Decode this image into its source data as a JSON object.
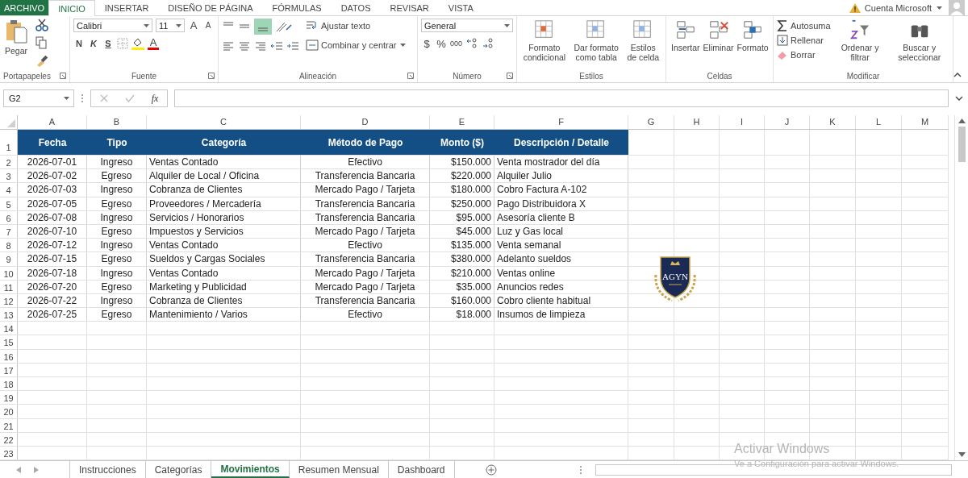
{
  "menu_tabs": [
    {
      "label": "ARCHIVO",
      "kind": "file",
      "selected": false
    },
    {
      "label": "INICIO",
      "kind": "tab",
      "selected": true
    },
    {
      "label": "INSERTAR",
      "kind": "tab",
      "selected": false
    },
    {
      "label": "DISEÑO DE PÁGINA",
      "kind": "tab",
      "selected": false
    },
    {
      "label": "FÓRMULAS",
      "kind": "tab",
      "selected": false
    },
    {
      "label": "DATOS",
      "kind": "tab",
      "selected": false
    },
    {
      "label": "REVISAR",
      "kind": "tab",
      "selected": false
    },
    {
      "label": "VISTA",
      "kind": "tab",
      "selected": false
    }
  ],
  "account": "Cuenta Microsoft",
  "ribbon": {
    "clipboard": {
      "paste": "Pegar",
      "label": "Portapapeles"
    },
    "font": {
      "name": "Calibri",
      "size": "11",
      "grow": "A",
      "shrink": "A",
      "bold": "N",
      "italic": "K",
      "underline": "S",
      "font_color": "A",
      "label": "Fuente"
    },
    "alignment": {
      "wrap": "Ajustar texto",
      "merge": "Combinar y centrar",
      "label": "Alineación"
    },
    "number": {
      "format": "General",
      "currency": "$",
      "percent": "%",
      "thousands": "000",
      "label": "Número"
    },
    "styles": {
      "buttons": [
        "Formato condicional",
        "Dar formato como tabla",
        "Estilos de celda"
      ],
      "label": "Estilos"
    },
    "cells": {
      "buttons": [
        "Insertar",
        "Eliminar",
        "Formato"
      ],
      "label": "Celdas"
    },
    "editing": {
      "autosum": "Autosuma",
      "fill": "Rellenar",
      "clear": "Borrar",
      "sort": "Ordenar y filtrar",
      "find": "Buscar y seleccionar",
      "label": "Modificar"
    }
  },
  "formula_bar": {
    "name_box": "G2",
    "function_label": "fx"
  },
  "columns": [
    "A",
    "B",
    "C",
    "D",
    "E",
    "F",
    "G",
    "H",
    "I",
    "J",
    "K",
    "L",
    "M"
  ],
  "row_numbers": [
    "1",
    "2",
    "3",
    "4",
    "5",
    "6",
    "7",
    "8",
    "9",
    "10",
    "11",
    "12",
    "13",
    "14",
    "15",
    "16",
    "17",
    "18",
    "19",
    "20",
    "21",
    "22",
    "23"
  ],
  "table": {
    "headers": [
      "Fecha",
      "Tipo",
      "Categoría",
      "Método de Pago",
      "Monto ($)",
      "Descripción / Detalle"
    ],
    "rows": [
      [
        "2026-07-01",
        "Ingreso",
        "Ventas Contado",
        "Efectivo",
        "$150.000",
        "Venta mostrador del día"
      ],
      [
        "2026-07-02",
        "Egreso",
        "Alquiler de Local / Oficina",
        "Transferencia Bancaria",
        "$220.000",
        "Alquiler Julio"
      ],
      [
        "2026-07-03",
        "Ingreso",
        "Cobranza de Clientes",
        "Mercado Pago / Tarjeta",
        "$180.000",
        "Cobro Factura A-102"
      ],
      [
        "2026-07-05",
        "Egreso",
        "Proveedores / Mercadería",
        "Transferencia Bancaria",
        "$250.000",
        "Pago Distribuidora X"
      ],
      [
        "2026-07-08",
        "Ingreso",
        "Servicios / Honorarios",
        "Transferencia Bancaria",
        "$95.000",
        "Asesoría cliente B"
      ],
      [
        "2026-07-10",
        "Egreso",
        "Impuestos y Servicios",
        "Mercado Pago / Tarjeta",
        "$45.000",
        "Luz y Gas local"
      ],
      [
        "2026-07-12",
        "Ingreso",
        "Ventas Contado",
        "Efectivo",
        "$135.000",
        "Venta semanal"
      ],
      [
        "2026-07-15",
        "Egreso",
        "Sueldos y Cargas Sociales",
        "Transferencia Bancaria",
        "$380.000",
        "Adelanto sueldos"
      ],
      [
        "2026-07-18",
        "Ingreso",
        "Ventas Contado",
        "Mercado Pago / Tarjeta",
        "$210.000",
        "Ventas online"
      ],
      [
        "2026-07-20",
        "Egreso",
        "Marketing y Publicidad",
        "Mercado Pago / Tarjeta",
        "$35.000",
        "Anuncios redes"
      ],
      [
        "2026-07-22",
        "Ingreso",
        "Cobranza de Clientes",
        "Transferencia Bancaria",
        "$160.000",
        "Cobro cliente habitual"
      ],
      [
        "2026-07-25",
        "Egreso",
        "Mantenimiento / Varios",
        "Efectivo",
        "$18.000",
        "Insumos de limpieza"
      ]
    ]
  },
  "logo": {
    "text": "AGYN"
  },
  "sheet_tabs": [
    {
      "label": "Instrucciones",
      "selected": false
    },
    {
      "label": "Categorías",
      "selected": false
    },
    {
      "label": "Movimientos",
      "selected": true
    },
    {
      "label": "Resumen Mensual",
      "selected": false
    },
    {
      "label": "Dashboard",
      "selected": false
    }
  ],
  "activation": {
    "title": "Activar Windows",
    "subtitle": "Ve a Configuración para activar Windows."
  }
}
